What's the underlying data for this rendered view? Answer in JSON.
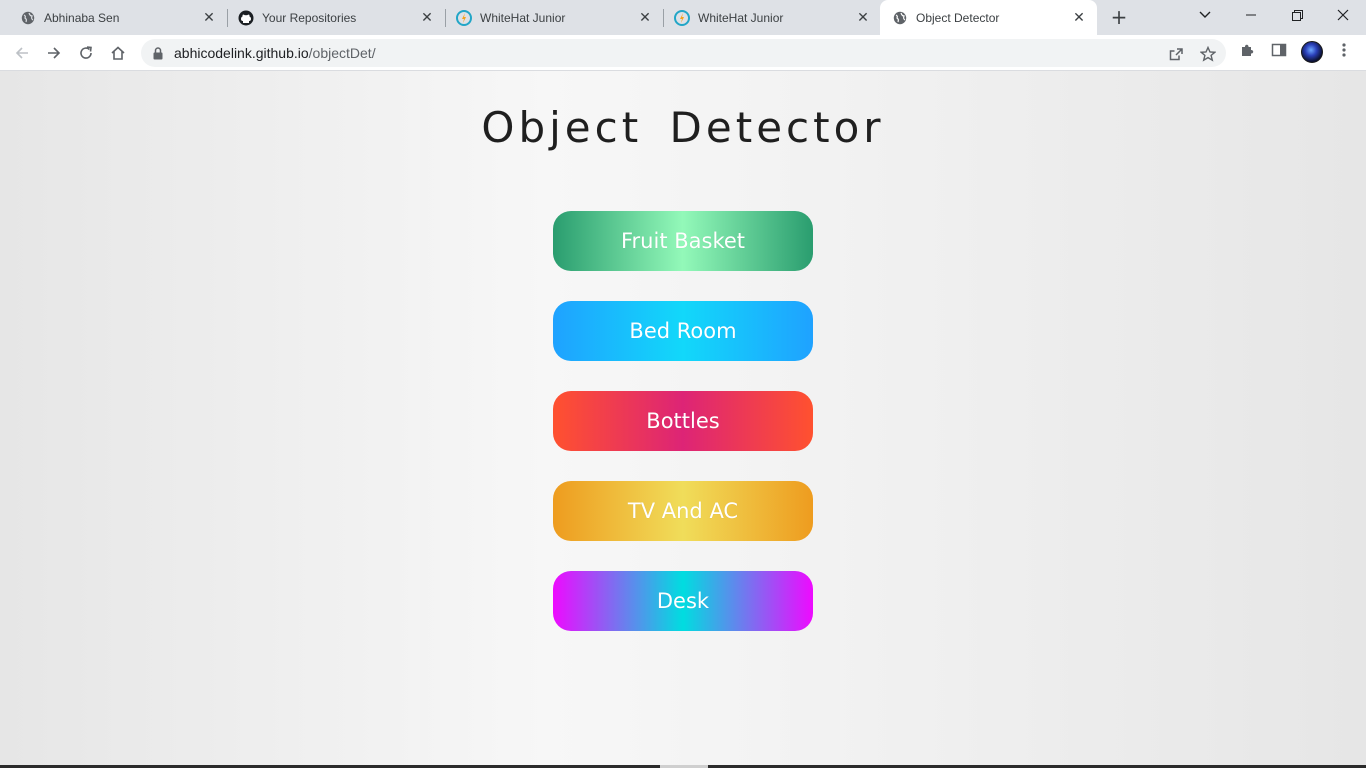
{
  "browser": {
    "tabs": [
      {
        "title": "Abhinaba Sen",
        "icon": "globe-icon"
      },
      {
        "title": "Your Repositories",
        "icon": "github-icon"
      },
      {
        "title": "WhiteHat Junior",
        "icon": "whitehat-icon"
      },
      {
        "title": "WhiteHat Junior",
        "icon": "whitehat-icon"
      },
      {
        "title": "Object Detector",
        "icon": "globe-icon",
        "active": true
      }
    ],
    "url_host": "abhicodelink.github.io",
    "url_path": "/objectDet/"
  },
  "page": {
    "title": "Object Detector",
    "buttons": [
      {
        "label": "Fruit Basket",
        "gradient": [
          "#2a9d6f",
          "#93f9b9",
          "#2a9d6f"
        ]
      },
      {
        "label": "Bed Room",
        "gradient": [
          "#1fa2ff",
          "#12d8fa",
          "#1fa2ff"
        ]
      },
      {
        "label": "Bottles",
        "gradient": [
          "#ff512f",
          "#dd2476",
          "#ff512f"
        ]
      },
      {
        "label": "TV And AC",
        "gradient": [
          "#ee9c1f",
          "#f0dd5a",
          "#ee9c1f"
        ]
      },
      {
        "label": "Desk",
        "gradient": [
          "#ee0aff",
          "#00dde0",
          "#ee0aff"
        ]
      }
    ]
  }
}
